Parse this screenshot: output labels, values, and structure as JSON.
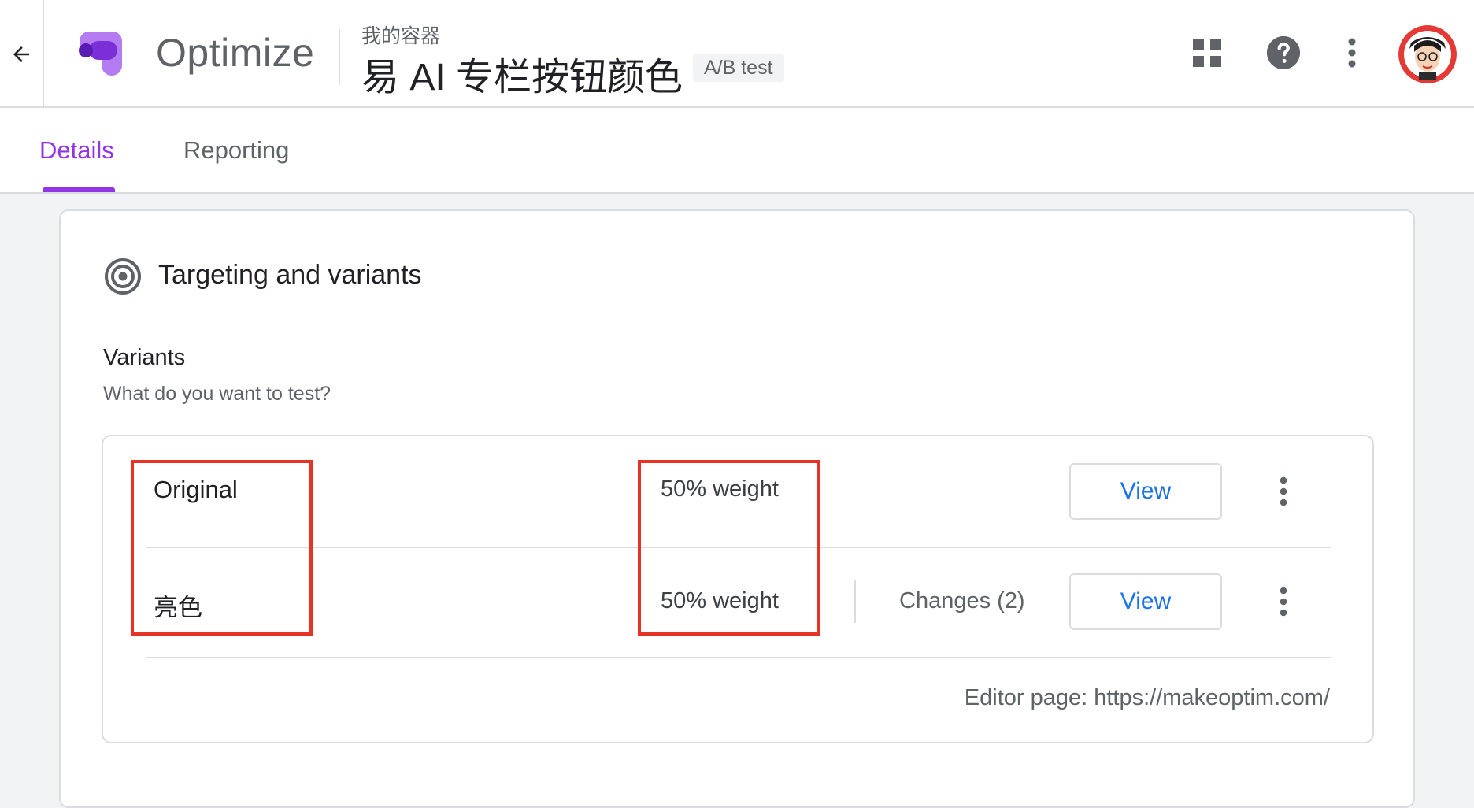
{
  "header": {
    "app_name": "Optimize",
    "container_name": "我的容器",
    "experiment_title": "易 AI 专栏按钮颜色",
    "experiment_type": "A/B test",
    "icons": [
      "back-arrow-icon",
      "optimize-logo-icon",
      "apps-grid-icon",
      "help-icon",
      "more-vert-icon",
      "avatar"
    ]
  },
  "tabs": [
    {
      "label": "Details",
      "active": true
    },
    {
      "label": "Reporting",
      "active": false
    }
  ],
  "card": {
    "title": "Targeting and variants",
    "icon": "target-icon",
    "variants_heading": "Variants",
    "variants_subtitle": "What do you want to test?",
    "variants": [
      {
        "name": "Original",
        "weight": "50% weight",
        "view_label": "View"
      },
      {
        "name": "亮色",
        "weight": "50% weight",
        "changes": "Changes (2)",
        "view_label": "View"
      }
    ],
    "editor_page": "Editor page: https://makeoptim.com/"
  },
  "colors": {
    "accent": "#9334e6",
    "link_blue": "#1a73e8",
    "highlight_red": "#e53325",
    "border": "#dadce0"
  }
}
